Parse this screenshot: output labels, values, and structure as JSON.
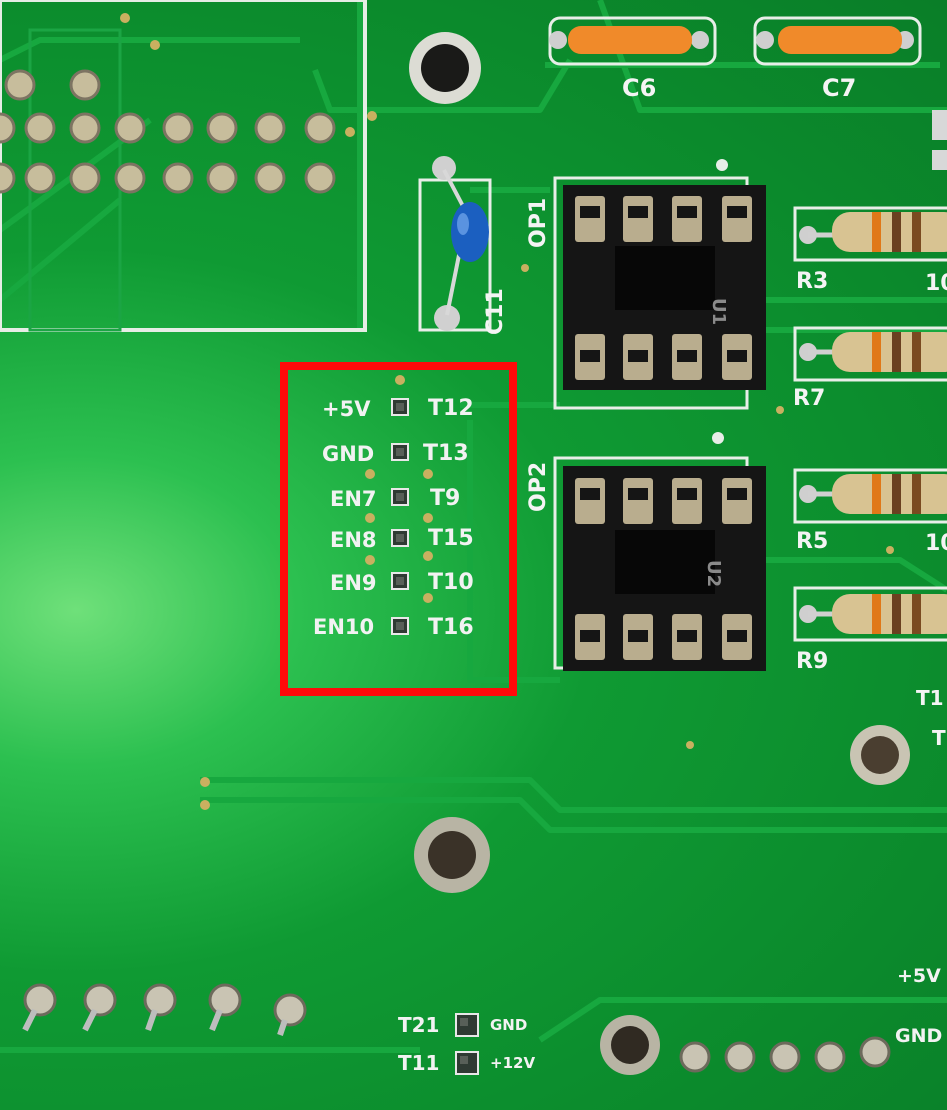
{
  "components": {
    "capacitors": {
      "c6": "C6",
      "c7": "C7",
      "c11": "C11"
    },
    "sockets": {
      "op1": "OP1",
      "op2": "OP2",
      "op1_mark": "U1",
      "op2_mark": "U2"
    },
    "resistors": {
      "r3": "R3",
      "r7": "R7",
      "r5": "R5",
      "r9": "R9",
      "r3_value_partial": "10",
      "r5_value_partial": "10"
    }
  },
  "test_points": {
    "rows": [
      {
        "left": "+5V",
        "right": "T12"
      },
      {
        "left": "GND",
        "right": "T13"
      },
      {
        "left": "EN7",
        "right": "T9"
      },
      {
        "left": "EN8",
        "right": "T15"
      },
      {
        "left": "EN9",
        "right": "T10"
      },
      {
        "left": "EN10",
        "right": "T16"
      }
    ]
  },
  "bottom": {
    "t21": "T21",
    "t21_net": "GND",
    "t11": "T11",
    "t11_net": "+12V",
    "right_5v": "+5V",
    "right_gnd": "GND"
  },
  "right_edge": {
    "t1_partial": "T1",
    "t_partial": "T"
  },
  "colors": {
    "board": "#0b8a2c",
    "silkscreen": "#f2f2f2",
    "highlight": "#ff0a0a",
    "socket": "#151515",
    "pad_metal": "#b9ad8e"
  }
}
